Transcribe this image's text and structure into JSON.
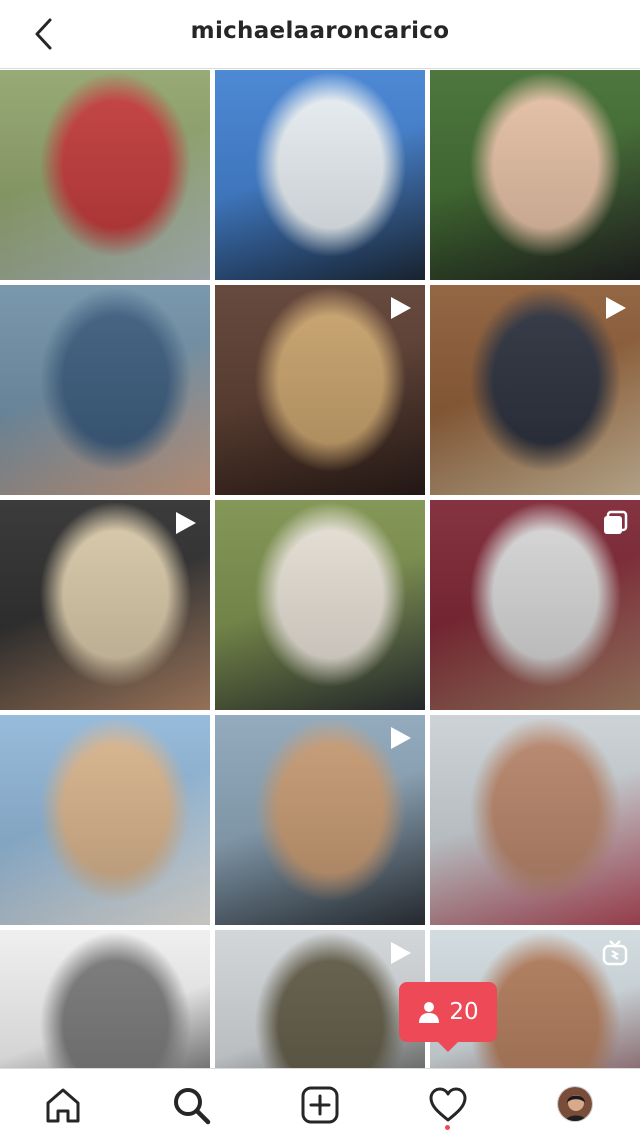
{
  "header": {
    "username": "michaelaaroncarico",
    "back_icon": "chevron-left-icon"
  },
  "grid": {
    "posts": [
      {
        "name": "post-golf-driving-range",
        "badge": "none",
        "colors": [
          "#8fa36a",
          "#c43a3a",
          "#b9c4c8"
        ]
      },
      {
        "name": "post-surfing-wave",
        "badge": "none",
        "colors": [
          "#3f7fd1",
          "#e9f0f4",
          "#1d2a3a"
        ]
      },
      {
        "name": "post-selfie-with-woman",
        "badge": "none",
        "colors": [
          "#3f6b2e",
          "#e7c1a5",
          "#222222"
        ]
      },
      {
        "name": "post-denim-motorcycle",
        "badge": "none",
        "colors": [
          "#6f8fa6",
          "#3b5c7e",
          "#d6a78a"
        ]
      },
      {
        "name": "post-drum-kit-overhead",
        "badge": "video",
        "colors": [
          "#5a3b2e",
          "#c9a26b",
          "#2a1c18"
        ]
      },
      {
        "name": "post-drum-kit-studio",
        "badge": "video",
        "colors": [
          "#8b5a34",
          "#2a2f3c",
          "#d7c3a1"
        ]
      },
      {
        "name": "post-drumming-booth",
        "badge": "video",
        "colors": [
          "#2b2b2b",
          "#d9c9a8",
          "#b5896a"
        ]
      },
      {
        "name": "post-motorcycle-road",
        "badge": "none",
        "colors": [
          "#7a8f4a",
          "#e7e1d6",
          "#2b2f33"
        ]
      },
      {
        "name": "post-lying-on-bed",
        "badge": "carousel",
        "colors": [
          "#7b2230",
          "#d7d7d7",
          "#a8856a"
        ]
      },
      {
        "name": "post-beach-shirtless",
        "badge": "none",
        "colors": [
          "#8fb6d8",
          "#d9b48c",
          "#f2efe9"
        ]
      },
      {
        "name": "post-gym-workout",
        "badge": "video",
        "colors": [
          "#8aa4b8",
          "#c79a72",
          "#2d3238"
        ]
      },
      {
        "name": "post-headshot-portrait",
        "badge": "none",
        "colors": [
          "#c9d0d4",
          "#b8856a",
          "#b54a5a"
        ]
      },
      {
        "name": "post-black-white-portrait",
        "badge": "none",
        "colors": [
          "#eeeeee",
          "#777777",
          "#222222"
        ]
      },
      {
        "name": "post-soldier-field",
        "badge": "video",
        "colors": [
          "#cfd3d6",
          "#5f5a46",
          "#2a2a24"
        ]
      },
      {
        "name": "post-character-grin",
        "badge": "igtv",
        "colors": [
          "#cfd9dd",
          "#b07a5a",
          "#6e2a2f"
        ]
      }
    ]
  },
  "likes_popup": {
    "count": "20",
    "icon": "person-icon",
    "color": "#ed4956"
  },
  "nav": {
    "items": [
      {
        "name": "nav-home",
        "icon": "home-icon"
      },
      {
        "name": "nav-search",
        "icon": "search-icon"
      },
      {
        "name": "nav-new-post",
        "icon": "plus-square-icon"
      },
      {
        "name": "nav-activity",
        "icon": "heart-icon"
      },
      {
        "name": "nav-profile",
        "icon": "avatar"
      }
    ]
  }
}
